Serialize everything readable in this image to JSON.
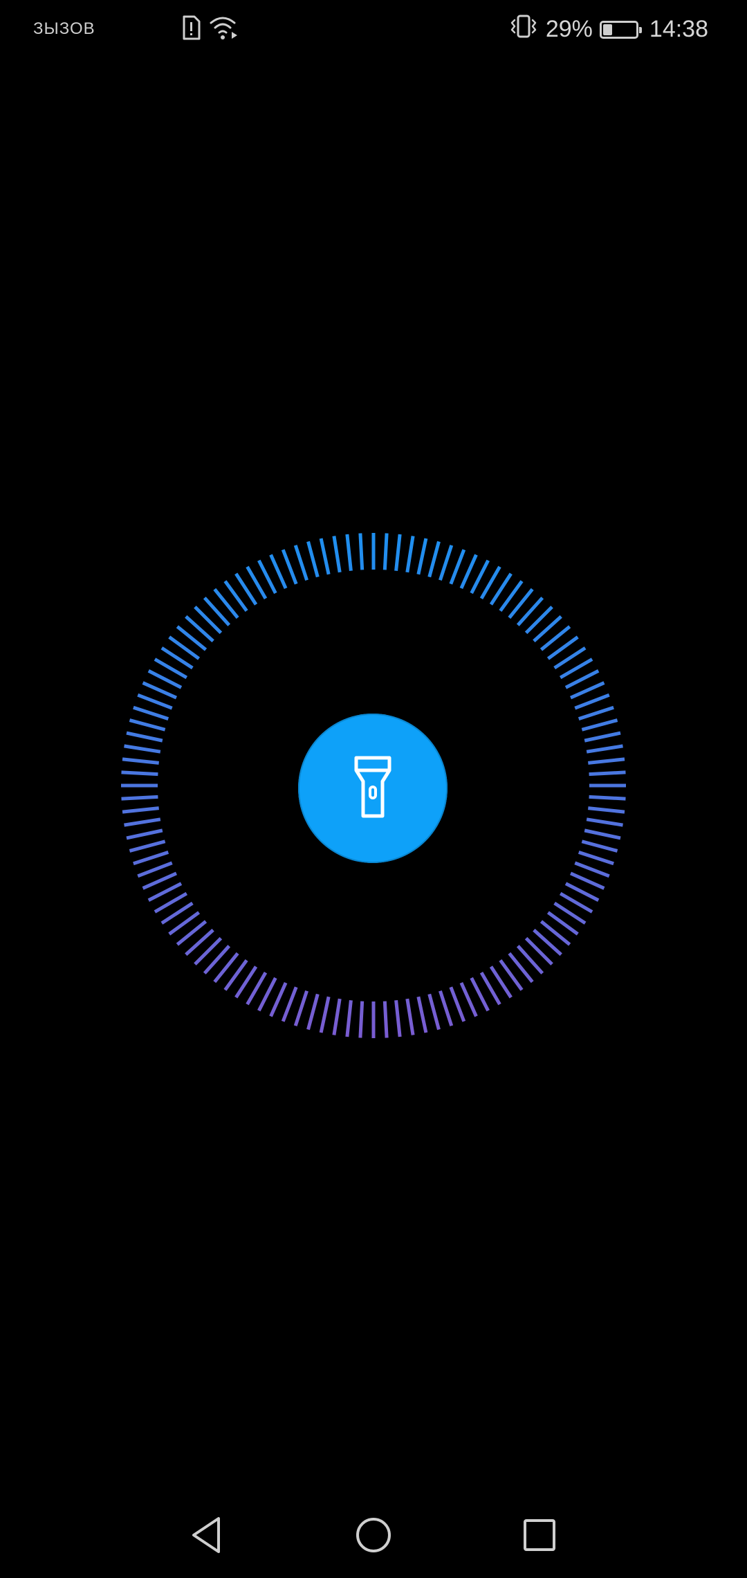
{
  "status_bar": {
    "carrier_text": "ЗЫЗОВ",
    "battery_percent_text": "29%",
    "battery_level": 0.29,
    "time": "14:38",
    "icons": [
      "sim-alert-icon",
      "wifi-icon",
      "vibrate-icon",
      "battery-icon"
    ]
  },
  "flashlight": {
    "icon": "flashlight-icon",
    "state": "on",
    "colors": {
      "button": "#0ea1f9",
      "ring_top": "#1e90f0",
      "ring_bottom": "#7a5cd1"
    }
  },
  "nav_bar": {
    "icons": [
      "back-icon",
      "home-icon",
      "recents-icon"
    ]
  }
}
